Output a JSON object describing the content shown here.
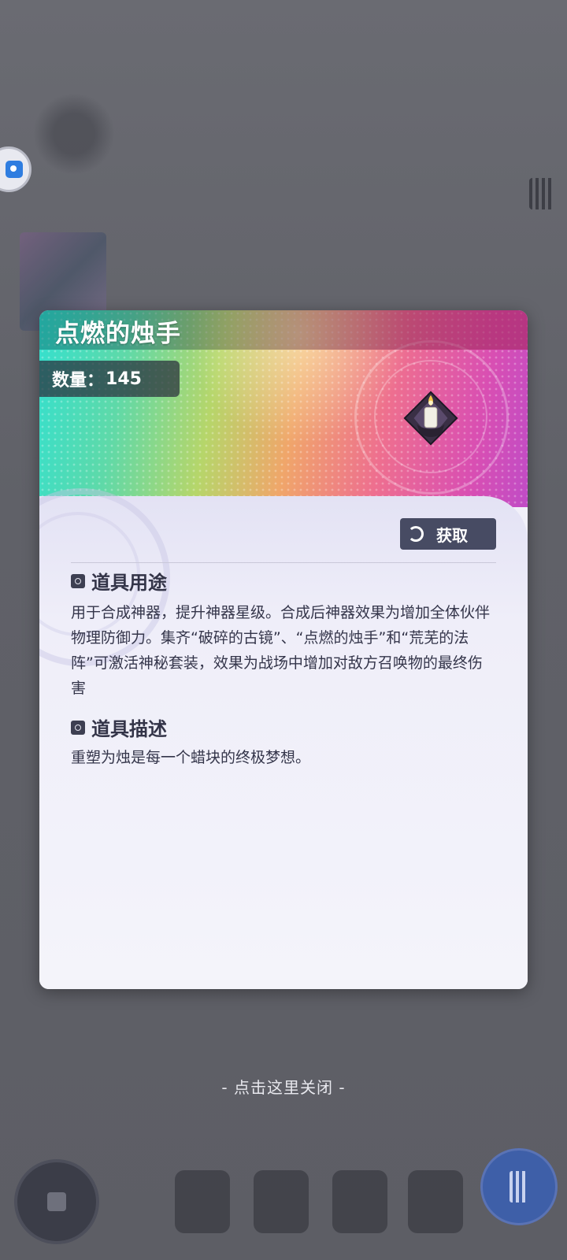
{
  "item": {
    "name": "点燃的烛手",
    "quantity_label": "数量：",
    "quantity_value": "145",
    "acquire_label": "获取"
  },
  "sections": {
    "usage_title": "道具用途",
    "usage_text": "用于合成神器，提升神器星级。合成后神器效果为增加全体伙伴物理防御力。集齐“破碎的古镜”、“点燃的烛手”和“荒芜的法阵”可激活神秘套装，效果为战场中增加对敌方召唤物的最终伤害",
    "desc_title": "道具描述",
    "desc_text": "重塑为烛是每一个蜡块的终极梦想。"
  },
  "close_hint": "- 点击这里关闭 -",
  "colors": {
    "overlay": "#5e5f66",
    "panel": "#f1f0f9",
    "button": "#474b63",
    "text": "#34354a"
  }
}
